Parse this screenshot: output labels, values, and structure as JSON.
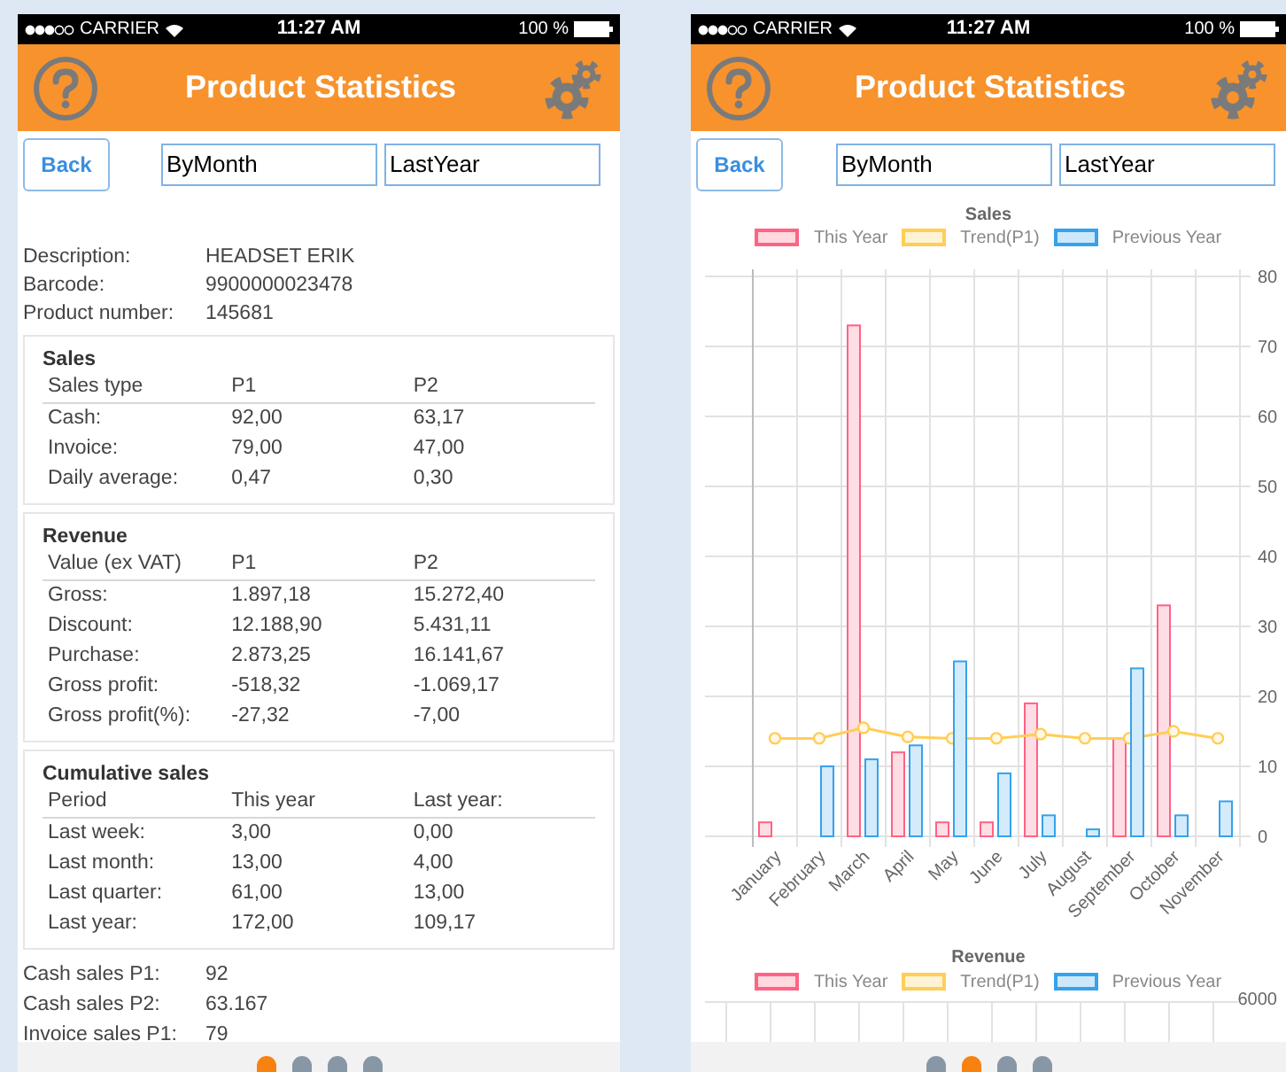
{
  "screens": [
    {
      "kind": "details",
      "status_bar": {
        "carrier": "CARRIER",
        "time": "11:27 AM",
        "battery": "100 %"
      },
      "header": {
        "title": "Product Statistics"
      },
      "controls": {
        "back": "Back",
        "period": "ByMonth",
        "range": "LastYear"
      },
      "info": [
        {
          "label": "Description:",
          "value": "HEADSET ERIK"
        },
        {
          "label": "Barcode:",
          "value": "9900000023478"
        },
        {
          "label": "Product number:",
          "value": "145681"
        }
      ],
      "sections": [
        {
          "title": "Sales",
          "columns": [
            "Sales type",
            "P1",
            "P2"
          ],
          "rows": [
            [
              "Cash:",
              "92,00",
              "63,17"
            ],
            [
              "Invoice:",
              "79,00",
              "47,00"
            ],
            [
              "Daily average:",
              "0,47",
              "0,30"
            ]
          ]
        },
        {
          "title": "Revenue",
          "columns": [
            "Value (ex VAT)",
            "P1",
            "P2"
          ],
          "rows": [
            [
              "Gross:",
              "1.897,18",
              "15.272,40"
            ],
            [
              "Discount:",
              "12.188,90",
              "5.431,11"
            ],
            [
              "Purchase:",
              "2.873,25",
              "16.141,67"
            ],
            [
              "Gross profit:",
              "-518,32",
              "-1.069,17"
            ],
            [
              "Gross profit(%):",
              "-27,32",
              "-7,00"
            ]
          ]
        },
        {
          "title": "Cumulative sales",
          "columns": [
            "Period",
            "This year",
            "Last year:"
          ],
          "rows": [
            [
              "Last week:",
              "3,00",
              "0,00"
            ],
            [
              "Last month:",
              "13,00",
              "4,00"
            ],
            [
              "Last quarter:",
              "61,00",
              "13,00"
            ],
            [
              "Last year:",
              "172,00",
              "109,17"
            ]
          ]
        }
      ],
      "totals": [
        {
          "label": "Cash sales P1:",
          "value": "92"
        },
        {
          "label": "Cash sales P2:",
          "value": "63.167"
        },
        {
          "label": "Invoice sales P1:",
          "value": "79"
        }
      ],
      "pager": [
        {
          "selected": true
        },
        {
          "selected": false
        },
        {
          "selected": false
        },
        {
          "selected": false
        }
      ]
    },
    {
      "kind": "chart",
      "status_bar": {
        "carrier": "CARRIER",
        "time": "11:27 AM",
        "battery": "100 %"
      },
      "header": {
        "title": "Product Statistics"
      },
      "controls": {
        "back": "Back",
        "period": "ByMonth",
        "range": "LastYear"
      },
      "chart_data": {
        "type": "bar",
        "title": "Sales",
        "categories": [
          "January",
          "February",
          "March",
          "April",
          "May",
          "June",
          "July",
          "August",
          "September",
          "October",
          "November"
        ],
        "series": [
          {
            "name": "This Year",
            "color": "#ff6384",
            "values": [
              2,
              0,
              73,
              12,
              2,
              2,
              19,
              0,
              14,
              33,
              0
            ]
          },
          {
            "name": "Trend(P1)",
            "color": "#ffce56",
            "type": "line",
            "marker": "circle",
            "values": [
              14,
              14,
              15.5,
              14.2,
              14,
              14,
              14.6,
              14,
              14,
              15,
              14
            ]
          },
          {
            "name": "Previous Year",
            "color": "#36a2eb",
            "values": [
              0,
              10,
              11,
              13,
              25,
              9,
              3,
              1,
              24,
              3,
              5
            ]
          }
        ],
        "ylim": [
          0,
          80
        ],
        "grid": true,
        "legend": "top",
        "yticks": [
          0,
          10,
          20,
          30,
          40,
          50,
          60,
          70,
          80
        ]
      },
      "revenue_chart": {
        "title": "Revenue",
        "legend": [
          {
            "name": "This Year",
            "color": "#ff6384"
          },
          {
            "name": "Trend(P1)",
            "color": "#ffce56"
          },
          {
            "name": "Previous Year",
            "color": "#36a2eb"
          }
        ],
        "tick_label": "6000"
      },
      "pager": [
        {
          "selected": false
        },
        {
          "selected": true
        },
        {
          "selected": false
        },
        {
          "selected": false
        }
      ]
    }
  ]
}
